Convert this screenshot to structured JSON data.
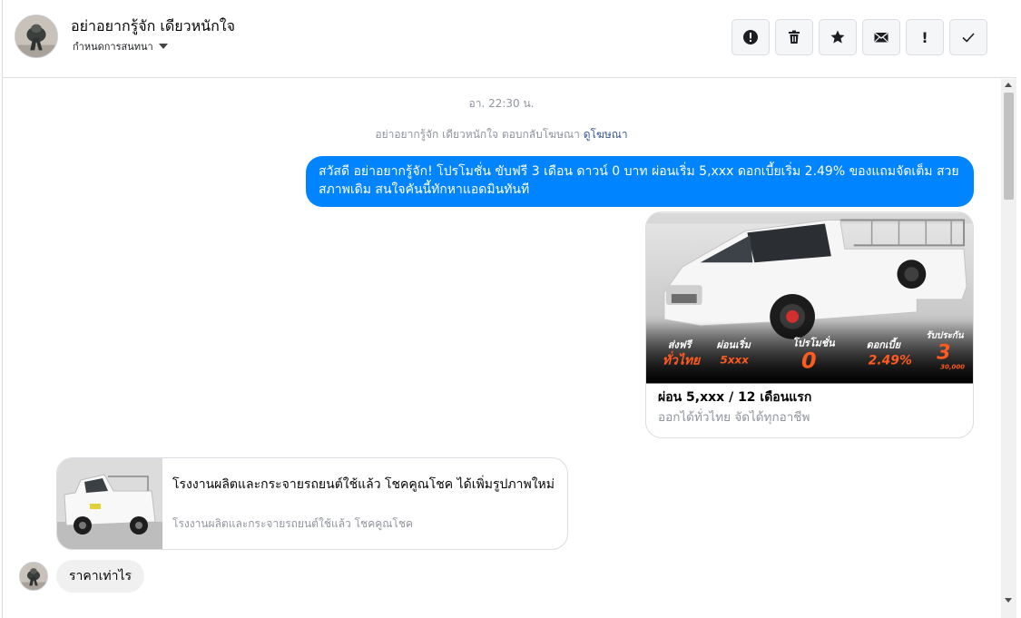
{
  "header": {
    "contact_name": "อย่าอยากรู้จัก เดียวหนักใจ",
    "conversation_settings": "กำหนดการสนทนา",
    "actions": [
      "alert-circle-icon",
      "trash-icon",
      "star-icon",
      "envelope-icon",
      "exclamation-icon",
      "check-icon"
    ],
    "exclamation_text": "!"
  },
  "thread": {
    "timestamp": "อา. 22:30 น.",
    "ad_reply_text": "อย่าอยากรู้จัก เดียวหนักใจ ตอบกลับโฆษณา",
    "ad_reply_link": "ดูโฆษณา",
    "outgoing_message": "สวัสดี อย่าอยากรู้จัก! โปรโมชั่น ขับฟรี 3 เดือน ดาวน์ 0 บาท ผ่อนเริ่ม 5,xxx  ดอกเบี้ยเริ่ม 2.49% ของแถมจัดเต็ม สวยสภาพเดิม สนใจคันนี้ทักหาแอดมินทันที",
    "ad_card": {
      "title": "ผ่อน 5,xxx / 12 เดือนแรก",
      "subtitle": "ออกได้ทั่วไทย จัดได้ทุกอาชีพ",
      "banner": {
        "free_delivery_1": "ส่งฟรี",
        "free_delivery_2": "ทั่วไทย",
        "installment_1": "ผ่อนเริ่ม",
        "installment_2": "5xxx",
        "promotion_1": "โปรโมชั่น",
        "promotion_2": "0",
        "interest_1": "ดอกเบี้ย",
        "interest_2": "2.49%",
        "warranty_1": "รับประกัน",
        "warranty_2": "3",
        "warranty_3": "30,000"
      }
    },
    "link_card": {
      "title": "โรงงานผลิตและกระจายรถยนต์ใช้แล้ว โชคคูณโชค ได้เพิ่มรูปภาพใหม่",
      "domain": "โรงงานผลิตและกระจายรถยนต์ใช้แล้ว โชคคูณโชค"
    },
    "incoming_message": "ราคาเท่าไร"
  },
  "colors": {
    "messenger_blue": "#0084ff",
    "incoming_bubble": "#f1f0f0",
    "banner_orange": "#ff5a1f",
    "link_blue": "#385898"
  }
}
